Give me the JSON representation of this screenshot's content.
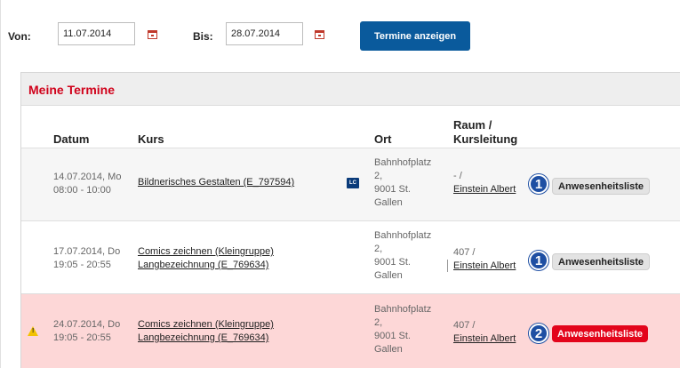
{
  "filter": {
    "von_label": "Von:",
    "von_value": "11.07.2014",
    "bis_label": "Bis:",
    "bis_value": "28.07.2014",
    "show_button": "Termine anzeigen"
  },
  "panel": {
    "title": "Meine Termine",
    "headers": {
      "datum": "Datum",
      "kurs": "Kurs",
      "ort": "Ort",
      "raum_line1": "Raum /",
      "raum_line2": "Kursleitung"
    },
    "rows": [
      {
        "date": "14.07.2014, Mo",
        "time": "08:00 - 10:00",
        "kurs_line1": "Bildnerisches Gestalten (E_797594)",
        "kurs_line2": "",
        "badge": "LC",
        "ort": [
          "Bahnhofplatz",
          "2,",
          "9001 St.",
          "Gallen"
        ],
        "raum": "- /",
        "leitung": "Einstein Albert",
        "number": "1",
        "button": "Anwesenheitsliste",
        "warning": false
      },
      {
        "date": "17.07.2014, Do",
        "time": "19:05 - 20:55",
        "kurs_line1": "Comics zeichnen (Kleingruppe)",
        "kurs_line2": "Langbezeichnung (E_769634)",
        "ort": [
          "Bahnhofplatz",
          "2,",
          "9001 St.",
          "Gallen"
        ],
        "raum": "407 /",
        "leitung": "Einstein Albert",
        "number": "1",
        "button": "Anwesenheitsliste",
        "warning": false
      },
      {
        "date": "24.07.2014, Do",
        "time": "19:05 - 20:55",
        "kurs_line1": "Comics zeichnen (Kleingruppe)",
        "kurs_line2": "Langbezeichnung (E_769634)",
        "ort": [
          "Bahnhofplatz",
          "2,",
          "9001 St.",
          "Gallen"
        ],
        "raum": "407 /",
        "leitung": "Einstein Albert",
        "number": "2",
        "button": "Anwesenheitsliste",
        "warning": true,
        "warning_glyph": "!"
      }
    ]
  },
  "colors": {
    "accent_blue": "#0a5a9c",
    "title_red": "#d0021b",
    "warning_row_bg": "#fdd7d7",
    "alert_button_red": "#e3051b"
  },
  "icons": [
    "calendar-icon",
    "lc-badge-icon",
    "number-circle-icon",
    "warning-icon"
  ]
}
